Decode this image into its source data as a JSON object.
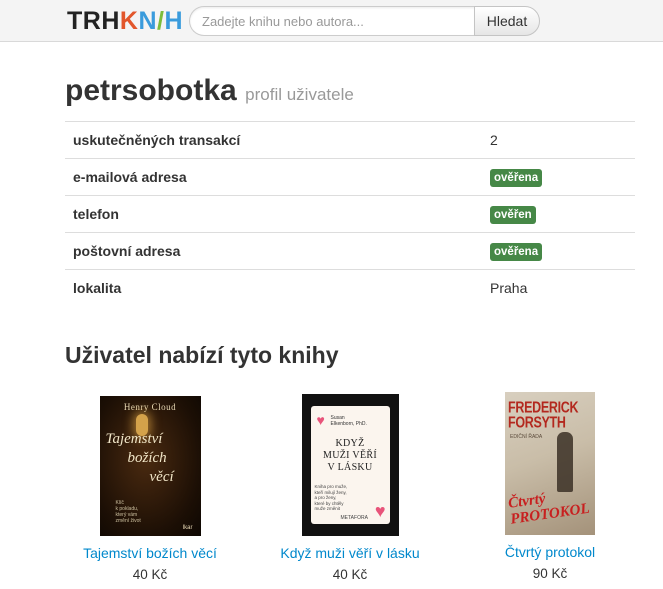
{
  "header": {
    "logo_parts": [
      "TRH",
      "K",
      "N",
      "/",
      "H"
    ],
    "search_placeholder": "Zadejte knihu nebo autora...",
    "search_value": "",
    "search_button_label": "Hledat",
    "brand_colors": {
      "dark": "#222222",
      "orange": "#e2562b",
      "blue": "#3a9bdc",
      "green": "#7cbd3b"
    }
  },
  "profile": {
    "username": "petrsobotka",
    "subtitle": "profil uživatele",
    "rows": [
      {
        "label": "uskutečněných transakcí",
        "value": "2"
      },
      {
        "label": "e-mailová adresa",
        "badge": "ověřena"
      },
      {
        "label": "telefon",
        "badge": "ověřen"
      },
      {
        "label": "poštovní adresa",
        "badge": "ověřena"
      },
      {
        "label": "lokalita",
        "value": "Praha"
      }
    ],
    "badge_color": "#468847"
  },
  "offers": {
    "title": "Uživatel nabízí tyto knihy",
    "books": [
      {
        "title": "Tajemství božích věcí",
        "price": "40 Kč",
        "cover": {
          "author": "Henry Cloud",
          "title_lines": [
            "Tajemství",
            "božích",
            "věcí"
          ],
          "blurb_lines": [
            "Klíč",
            "k pokladu,",
            "který vám",
            "změní život"
          ],
          "publisher": "Ikar"
        }
      },
      {
        "title": "Když muži věří v lásku",
        "price": "40 Kč",
        "cover": {
          "author_lines": [
            "Susan",
            "Elkenborn, PhD."
          ],
          "title_lines": [
            "KDYŽ",
            "MUŽI VĚŘÍ",
            "V LÁSKU"
          ],
          "blurb_lines": [
            "Kniha pro muže,",
            "kteří milují ženy,",
            "a pro ženy,",
            "které by chtěly",
            "muže změnit"
          ],
          "publisher": "METAFORA"
        }
      },
      {
        "title": "Čtvrtý protokol",
        "price": "90 Kč",
        "cover": {
          "author_lines": [
            "FREDERICK",
            "FORSYTH"
          ],
          "subtitle": "EDIČNÍ ŘADA",
          "title_lines": [
            "Čtvrtý",
            "PROTOKOL"
          ]
        }
      }
    ],
    "link_color": "#0088cc"
  }
}
